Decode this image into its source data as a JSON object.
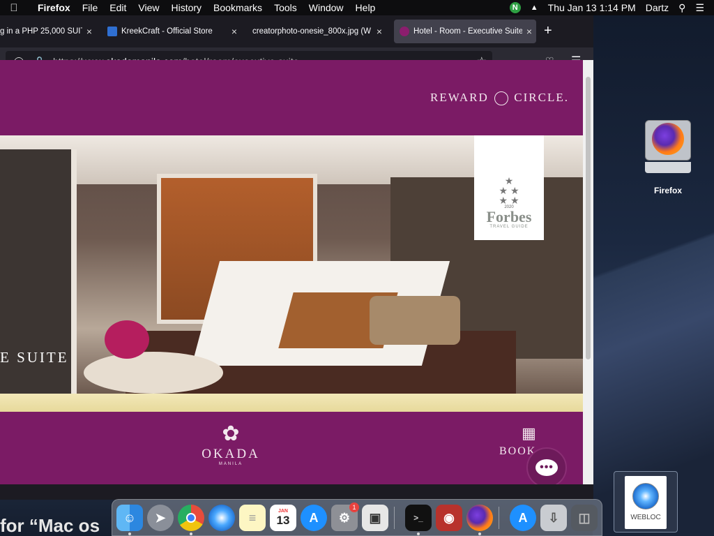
{
  "menubar": {
    "app_name": "Firefox",
    "items": [
      "File",
      "Edit",
      "View",
      "History",
      "Bookmarks",
      "Tools",
      "Window",
      "Help"
    ],
    "clock": "Thu Jan 13  1:14 PM",
    "user": "Dartz",
    "status_icon_letter": "N"
  },
  "browser": {
    "tabs": [
      {
        "title": "g in a PHP 25,000 SUITE",
        "favicon_color": "#6b7280"
      },
      {
        "title": "KreekCraft - Official Store",
        "favicon_color": "#3b82f6"
      },
      {
        "title": "creatorphoto-onesie_800x.jpg (W",
        "favicon_color": "#1c1b22"
      },
      {
        "title": "Hotel - Room - Executive Suite",
        "favicon_color": "#8b1e6e",
        "active": true
      }
    ],
    "new_tab_label": "+",
    "url_prefix": "https://www.",
    "url_domain": "okadamanila.com",
    "url_path": "/hotel/room/executive-suite"
  },
  "page": {
    "reward_left": "REWARD",
    "reward_right": "CIRCLE.",
    "suite_text": "E SUITE",
    "forbes": {
      "year": "2020",
      "name": "Forbes",
      "guide": "TRAVEL GUIDE"
    },
    "okada_name": "OKADA",
    "okada_sub": "MANILA",
    "book_label": "BOOK",
    "chat_icon": "chat-icon"
  },
  "desktop": {
    "firefox_label": "Firefox",
    "webloc_label": "WEBLOC",
    "bottom_text": "for “Mac os"
  },
  "dock": {
    "calendar_month": "JAN",
    "calendar_day": "13",
    "sysprefs_badge": "1",
    "apps": [
      "Finder",
      "Launchpad",
      "Chrome",
      "Safari",
      "Notes",
      "Calendar",
      "App Store",
      "System Preferences",
      "Roblox",
      "Terminal",
      "Photo Booth",
      "Firefox",
      "App Store",
      "Downloads",
      "Trash"
    ]
  }
}
